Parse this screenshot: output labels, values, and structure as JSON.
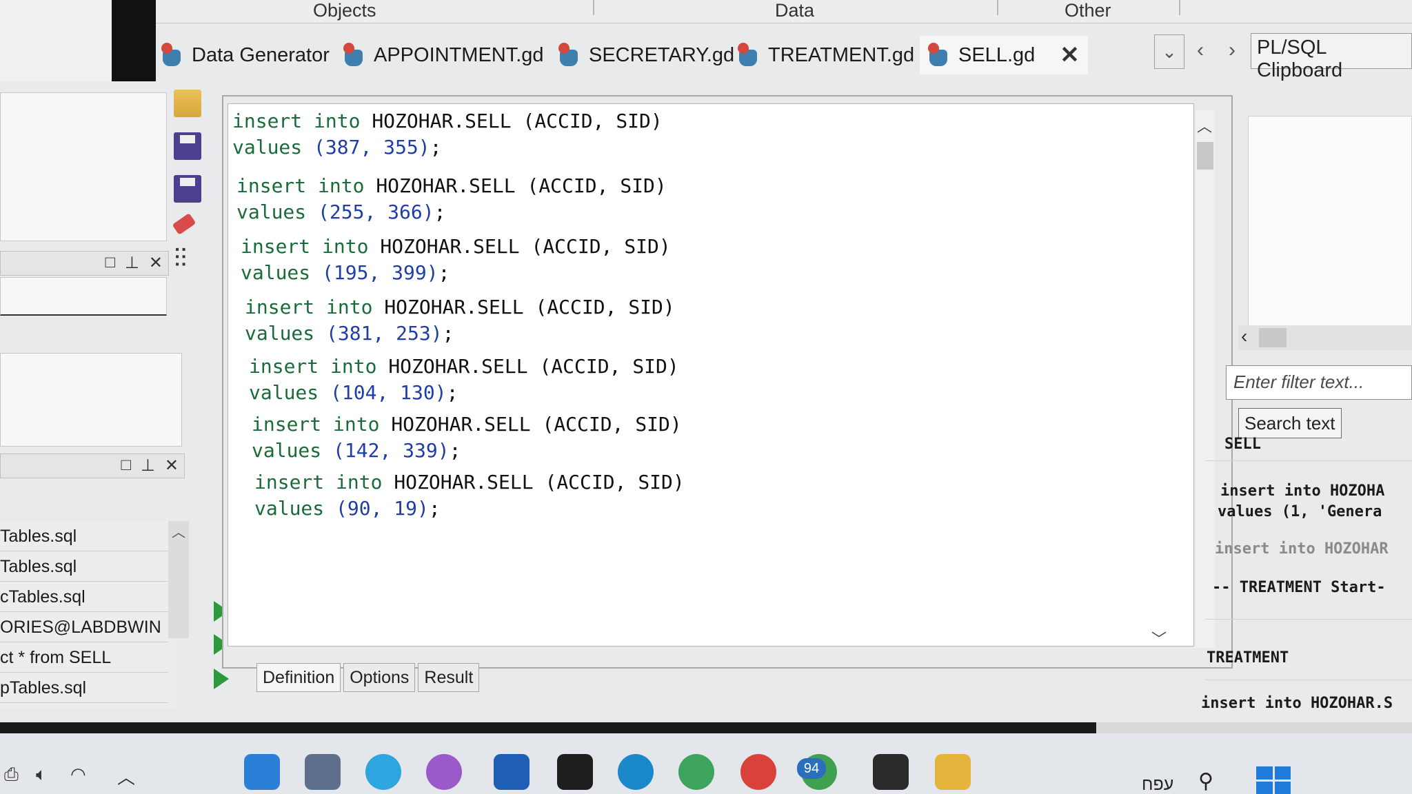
{
  "menu_categories": [
    "Objects",
    "Data",
    "Other"
  ],
  "tabs": [
    {
      "label": "Data Generator"
    },
    {
      "label": "APPOINTMENT.gd"
    },
    {
      "label": "SECRETARY.gd"
    },
    {
      "label": "TREATMENT.gd"
    },
    {
      "label": "SELL.gd",
      "active": true
    }
  ],
  "tab_close_glyph": "✕",
  "tab_nav": {
    "dropdown": "⌄",
    "prev": "‹",
    "next": "›"
  },
  "clipboard_tab": "PL/SQL Clipboard",
  "editor": {
    "statements": [
      {
        "table": "HOZOHAR.SELL",
        "cols": "(ACCID, SID)",
        "values": "(387, 355)"
      },
      {
        "table": "HOZOHAR.SELL",
        "cols": "(ACCID, SID)",
        "values": "(255, 366)"
      },
      {
        "table": "HOZOHAR.SELL",
        "cols": "(ACCID, SID)",
        "values": "(195, 399)"
      },
      {
        "table": "HOZOHAR.SELL",
        "cols": "(ACCID, SID)",
        "values": "(381, 253)"
      },
      {
        "table": "HOZOHAR.SELL",
        "cols": "(ACCID, SID)",
        "values": "(104, 130)"
      },
      {
        "table": "HOZOHAR.SELL",
        "cols": "(ACCID, SID)",
        "values": "(142, 339)"
      },
      {
        "table": "HOZOHAR.SELL",
        "cols": "(ACCID, SID)",
        "values": "(90, 19)"
      }
    ],
    "kw_insert": "insert",
    "kw_into": "into",
    "kw_values": "values",
    "terminator": ";"
  },
  "bottom_tabs": [
    "Definition",
    "Options",
    "Result"
  ],
  "file_list": [
    "Tables.sql",
    "Tables.sql",
    "cTables.sql",
    "ORIES@LABDBWIN",
    "ct * from SELL",
    "pTables.sql"
  ],
  "right_panel": {
    "filter_placeholder": "Enter filter text...",
    "tooltip": "Search text",
    "entries": [
      "SELL",
      "insert into HOZOHA",
      "values (1, 'Genera",
      "insert into HOZOHAR",
      "-- TREATMENT Start-",
      "TREATMENT",
      "insert into HOZOHAR.S"
    ]
  },
  "taskbar": {
    "badge_count": "94",
    "lang": "עפח",
    "apps": [
      "vscode-icon",
      "snipping-icon",
      "telegram-icon",
      "chrome-profile-icon",
      "word-icon",
      "sticky-notes-icon",
      "edge-icon",
      "chrome-icon",
      "chrome-icon-2",
      "whatsapp-icon",
      "terminal-icon",
      "file-explorer-icon"
    ]
  },
  "colors": {
    "keyword": "#1a6b3a",
    "number": "#1e3da8",
    "accent": "#1f7ad9"
  }
}
